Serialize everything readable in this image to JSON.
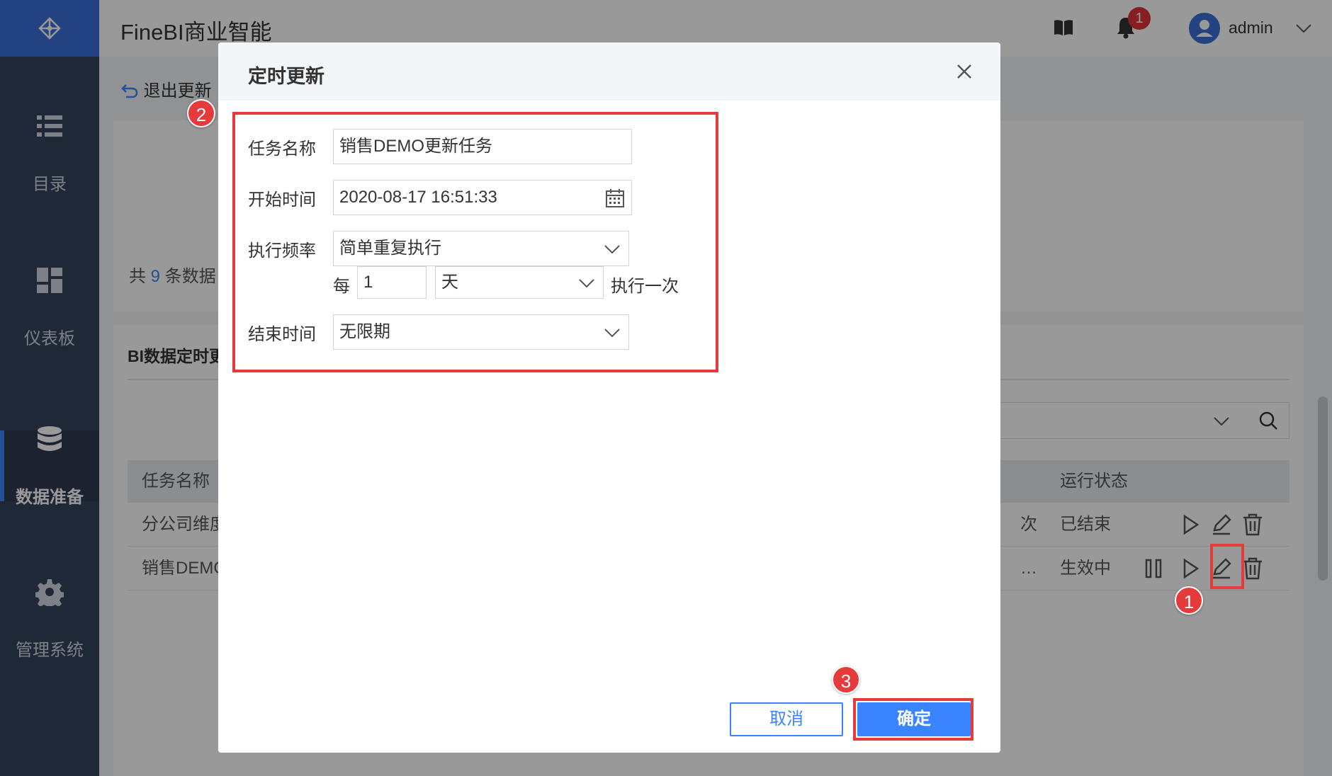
{
  "app": {
    "title": "FineBI商业智能",
    "user": "admin",
    "notification_count": "1"
  },
  "sidebar": {
    "items": [
      {
        "label": "目录",
        "icon": "list-icon"
      },
      {
        "label": "仪表板",
        "icon": "dashboard-icon"
      },
      {
        "label": "数据准备",
        "icon": "database-icon",
        "active": true
      },
      {
        "label": "管理系统",
        "icon": "gear-icon"
      }
    ]
  },
  "main": {
    "back_label": "退出更新",
    "count_prefix": "共",
    "count_value": "9",
    "count_suffix": "条数据",
    "section_title": "BI数据定时更新",
    "table": {
      "headers": [
        "任务名称",
        "运行状态"
      ],
      "rows": [
        {
          "name": "分公司维度",
          "freq": "次",
          "status": "已结束"
        },
        {
          "name": "销售DEMO",
          "freq": "…",
          "status": "生效中"
        }
      ]
    }
  },
  "dialog": {
    "title": "定时更新",
    "task_name_label": "任务名称",
    "task_name_value": "销售DEMO更新任务",
    "start_time_label": "开始时间",
    "start_time_value": "2020-08-17 16:51:33",
    "freq_label": "执行频率",
    "freq_value": "简单重复执行",
    "every_label": "每",
    "every_value": "1",
    "unit_value": "天",
    "exec_once_label": "执行一次",
    "end_time_label": "结束时间",
    "end_time_value": "无限期",
    "cancel_label": "取消",
    "ok_label": "确定"
  },
  "annotations": {
    "step1": "1",
    "step2": "2",
    "step3": "3",
    "color": "#e63b3b"
  },
  "colors": {
    "sidebar_bg": "#34435a",
    "accent": "#3a85ff",
    "logo_bg": "#3a6fd8"
  }
}
